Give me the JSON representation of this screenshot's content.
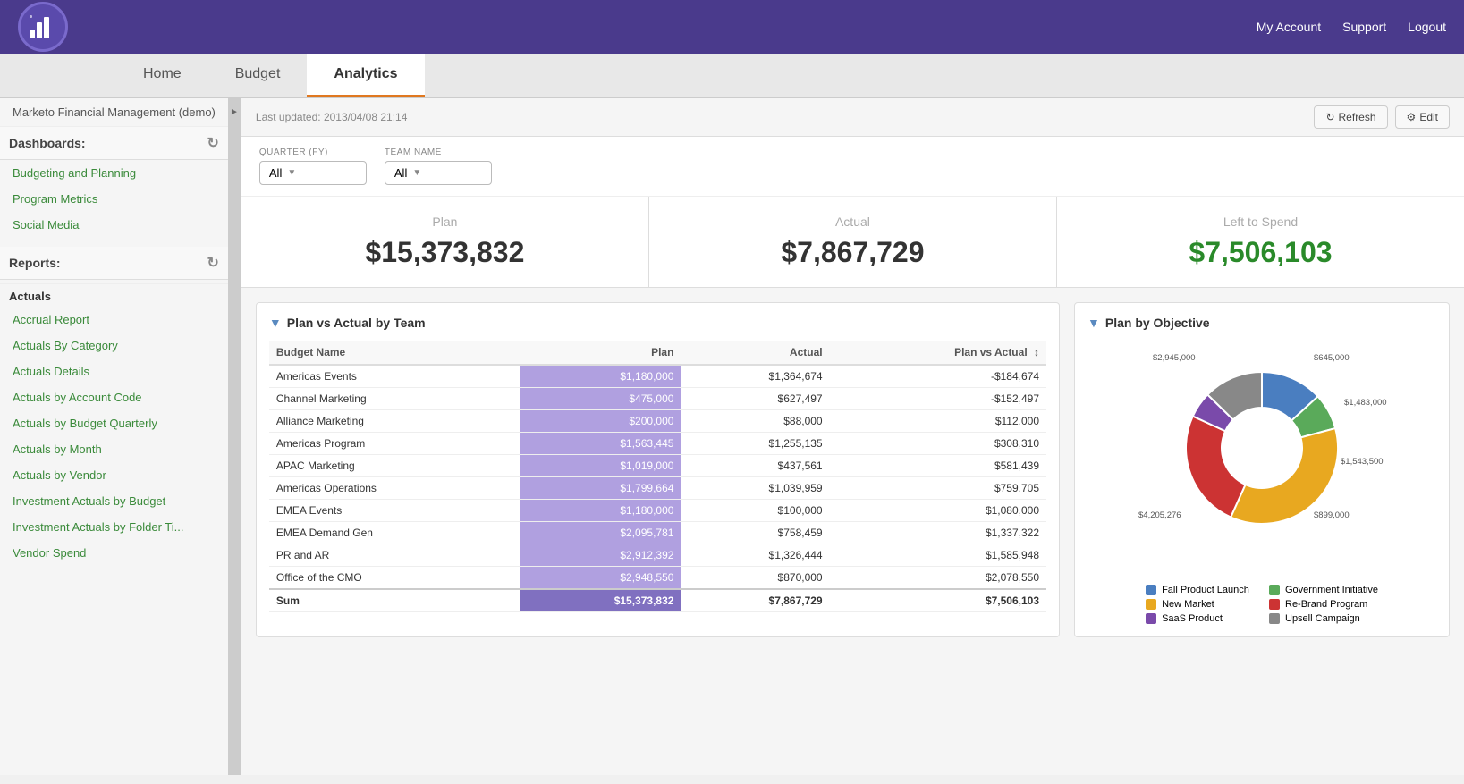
{
  "app": {
    "title": "Marketo Financial Management (demo)",
    "logo_alt": "Marketo logo"
  },
  "header": {
    "my_account": "My Account",
    "support": "Support",
    "logout": "Logout"
  },
  "nav": {
    "tabs": [
      {
        "label": "Home"
      },
      {
        "label": "Budget"
      },
      {
        "label": "Analytics",
        "active": true
      }
    ]
  },
  "sidebar": {
    "dashboards_label": "Dashboards:",
    "reports_label": "Reports:",
    "actuals_label": "Actuals",
    "dashboard_items": [
      {
        "label": "Budgeting and Planning"
      },
      {
        "label": "Program Metrics"
      },
      {
        "label": "Social Media"
      }
    ],
    "report_items": [
      {
        "label": "Accrual Report"
      },
      {
        "label": "Actuals By Category"
      },
      {
        "label": "Actuals Details"
      },
      {
        "label": "Actuals by Account Code"
      },
      {
        "label": "Actuals by Budget Quarterly"
      },
      {
        "label": "Actuals by Month"
      },
      {
        "label": "Actuals by Vendor"
      },
      {
        "label": "Investment Actuals by Budget"
      },
      {
        "label": "Investment Actuals by Folder Ti..."
      },
      {
        "label": "Vendor Spend"
      }
    ]
  },
  "content": {
    "last_updated": "Last updated: 2013/04/08 21:14",
    "refresh_btn": "Refresh",
    "edit_btn": "Edit",
    "filters": {
      "quarter_label": "QUARTER (FY)",
      "quarter_value": "All",
      "team_label": "TEAM NAME",
      "team_value": "All"
    },
    "kpis": {
      "plan_label": "Plan",
      "plan_value": "$15,373,832",
      "actual_label": "Actual",
      "actual_value": "$7,867,729",
      "left_label": "Left to Spend",
      "left_value": "$7,506,103"
    },
    "table": {
      "title": "Plan vs Actual by Team",
      "headers": [
        "Budget Name",
        "Plan",
        "Actual",
        "Plan vs Actual"
      ],
      "rows": [
        {
          "name": "Americas Events",
          "plan": "$1,180,000",
          "actual": "$1,364,674",
          "pva": "-$184,674",
          "neg": true
        },
        {
          "name": "Channel Marketing",
          "plan": "$475,000",
          "actual": "$627,497",
          "pva": "-$152,497",
          "neg": true
        },
        {
          "name": "Alliance Marketing",
          "plan": "$200,000",
          "actual": "$88,000",
          "pva": "$112,000",
          "neg": false
        },
        {
          "name": "Americas Program",
          "plan": "$1,563,445",
          "actual": "$1,255,135",
          "pva": "$308,310",
          "neg": false
        },
        {
          "name": "APAC Marketing",
          "plan": "$1,019,000",
          "actual": "$437,561",
          "pva": "$581,439",
          "neg": false
        },
        {
          "name": "Americas Operations",
          "plan": "$1,799,664",
          "actual": "$1,039,959",
          "pva": "$759,705",
          "neg": false
        },
        {
          "name": "EMEA Events",
          "plan": "$1,180,000",
          "actual": "$100,000",
          "pva": "$1,080,000",
          "neg": false
        },
        {
          "name": "EMEA Demand Gen",
          "plan": "$2,095,781",
          "actual": "$758,459",
          "pva": "$1,337,322",
          "neg": false
        },
        {
          "name": "PR and AR",
          "plan": "$2,912,392",
          "actual": "$1,326,444",
          "pva": "$1,585,948",
          "neg": false
        },
        {
          "name": "Office of the CMO",
          "plan": "$2,948,550",
          "actual": "$870,000",
          "pva": "$2,078,550",
          "neg": false
        }
      ],
      "sum_row": {
        "name": "Sum",
        "plan": "$15,373,832",
        "actual": "$7,867,729",
        "pva": "$7,506,103"
      }
    },
    "donut": {
      "title": "Plan by Objective",
      "segments": [
        {
          "label": "Fall Product Launch",
          "value": 1543500,
          "color": "#4a7ec0"
        },
        {
          "label": "Government Initiative",
          "value": 899000,
          "color": "#5aaa5a"
        },
        {
          "label": "New Market",
          "value": 4205276,
          "color": "#e8a820"
        },
        {
          "label": "Re-Brand Program",
          "value": 2945000,
          "color": "#cc3333"
        },
        {
          "label": "SaaS Product",
          "value": 645000,
          "color": "#7a4aaa"
        },
        {
          "label": "Upsell Campaign",
          "value": 1483000,
          "color": "#888888"
        }
      ],
      "labels": [
        {
          "text": "$2,945,000",
          "position": "top-left"
        },
        {
          "text": "$645,000",
          "position": "top-right"
        },
        {
          "text": "$1,483,000",
          "position": "right-top"
        },
        {
          "text": "$1,543,500",
          "position": "right-bottom"
        },
        {
          "text": "$899,000",
          "position": "bottom-right"
        },
        {
          "text": "$4,205,276",
          "position": "bottom-left"
        }
      ]
    }
  }
}
